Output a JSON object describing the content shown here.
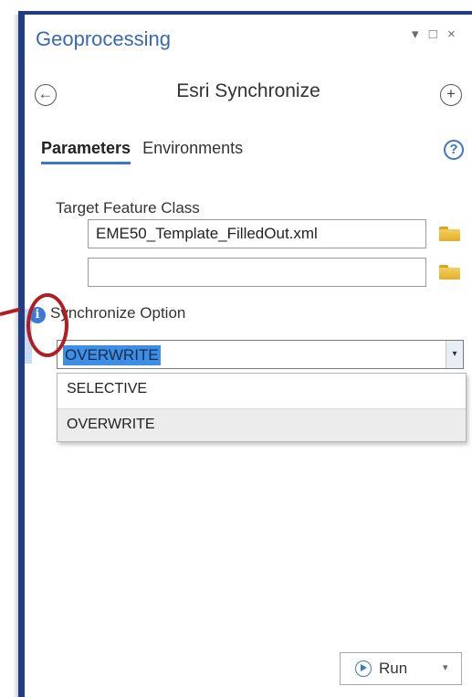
{
  "pane": {
    "title": "Geoprocessing",
    "controls": {
      "menu_glyph": "▾",
      "restore_glyph": "□",
      "close_glyph": "×"
    }
  },
  "nav": {
    "back_glyph": "←",
    "tool_name": "Esri Synchronize",
    "add_glyph": "+"
  },
  "tabs": [
    {
      "label": "Parameters",
      "active": true
    },
    {
      "label": "Environments",
      "active": false
    }
  ],
  "help_glyph": "?",
  "params": {
    "target_label": "Target Feature Class",
    "input1_value": "EME50_Template_FilledOut.xml",
    "input2_value": "",
    "sync_label": "Synchronize Option",
    "sync_value": "OVERWRITE",
    "info_glyph": "i",
    "arrow_glyph": "▾",
    "options": [
      "SELECTIVE",
      "OVERWRITE"
    ]
  },
  "run": {
    "label": "Run",
    "caret": "▾"
  },
  "colors": {
    "accent": "#3b78c9",
    "frame": "#1f3e84",
    "highlight": "#b01e24",
    "folder": "#f4cf5a"
  }
}
